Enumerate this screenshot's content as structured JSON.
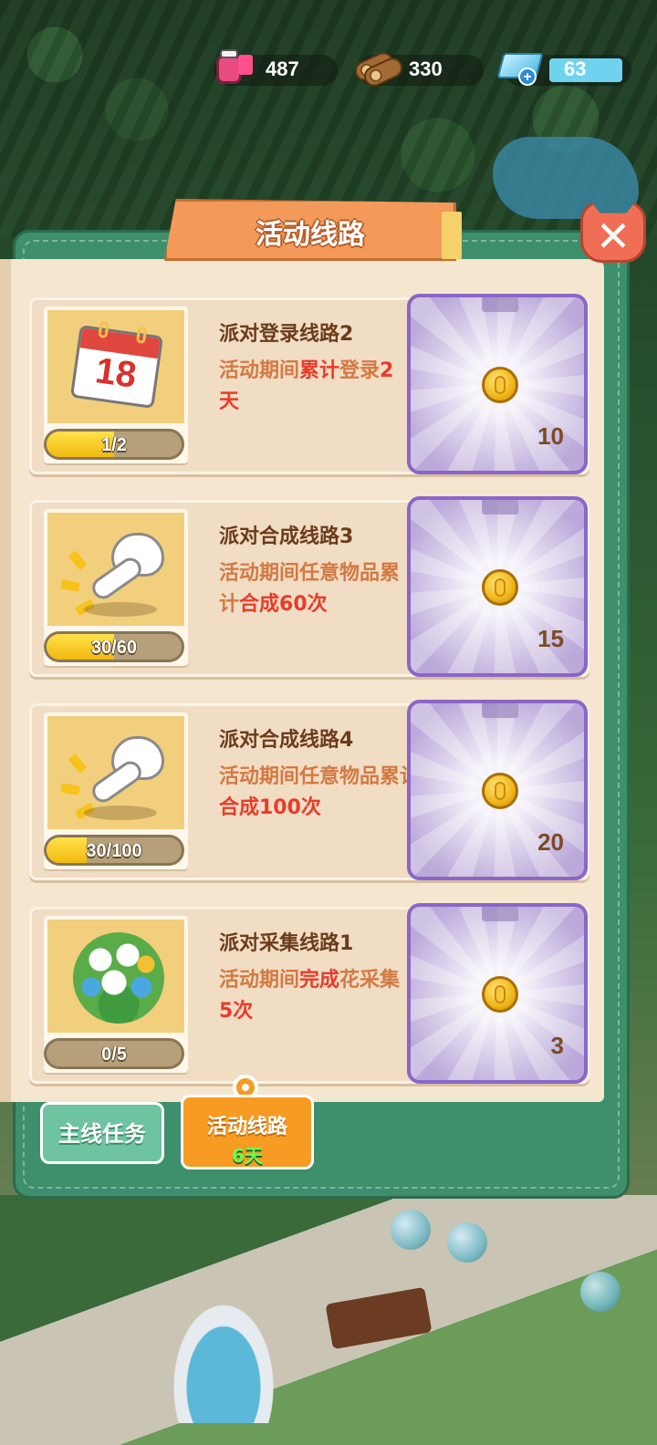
{
  "resources": {
    "ink": {
      "value": "487",
      "icon": "ink-bottle-icon"
    },
    "wood": {
      "value": "330",
      "icon": "wood-log-icon"
    },
    "gem": {
      "value": "63",
      "icon": "gem-icon"
    }
  },
  "dialog": {
    "title": "活动线路",
    "close_icon": "close-icon"
  },
  "tasks": [
    {
      "title": "派对登录线路2",
      "desc_parts": [
        "活动期间",
        "累计",
        "登录",
        "2天",
        ""
      ],
      "progress_text": "1/2",
      "progress": 0.5,
      "reward": "10",
      "calendar_number": "18",
      "icon": "calendar-icon"
    },
    {
      "title": "派对合成线路3",
      "desc_parts": [
        "活动期间任意物品累计",
        "合成60次",
        ""
      ],
      "progress_text": "30/60",
      "progress": 0.5,
      "reward": "15",
      "icon": "tap-hand-icon"
    },
    {
      "title": "派对合成线路4",
      "desc_parts": [
        "活动期间任意物品累计",
        "合成100次",
        ""
      ],
      "progress_text": "30/100",
      "progress": 0.3,
      "reward": "20",
      "icon": "tap-hand-icon"
    },
    {
      "title": "派对采集线路1",
      "desc_parts": [
        "活动期间",
        "完成",
        "花采集",
        "5次",
        ""
      ],
      "progress_text": "0/5",
      "progress": 0,
      "reward": "3",
      "icon": "flower-bush-icon"
    }
  ],
  "tabs": {
    "main_label": "主线任务",
    "event_label": "活动线路",
    "event_sub": "6天"
  },
  "colors": {
    "panel": "#3e8f6b",
    "highlight_text": "#e83c2a",
    "desc_text": "#d27a43",
    "reward_border": "#8b66c8",
    "progress_fill": "#f2b90e"
  }
}
